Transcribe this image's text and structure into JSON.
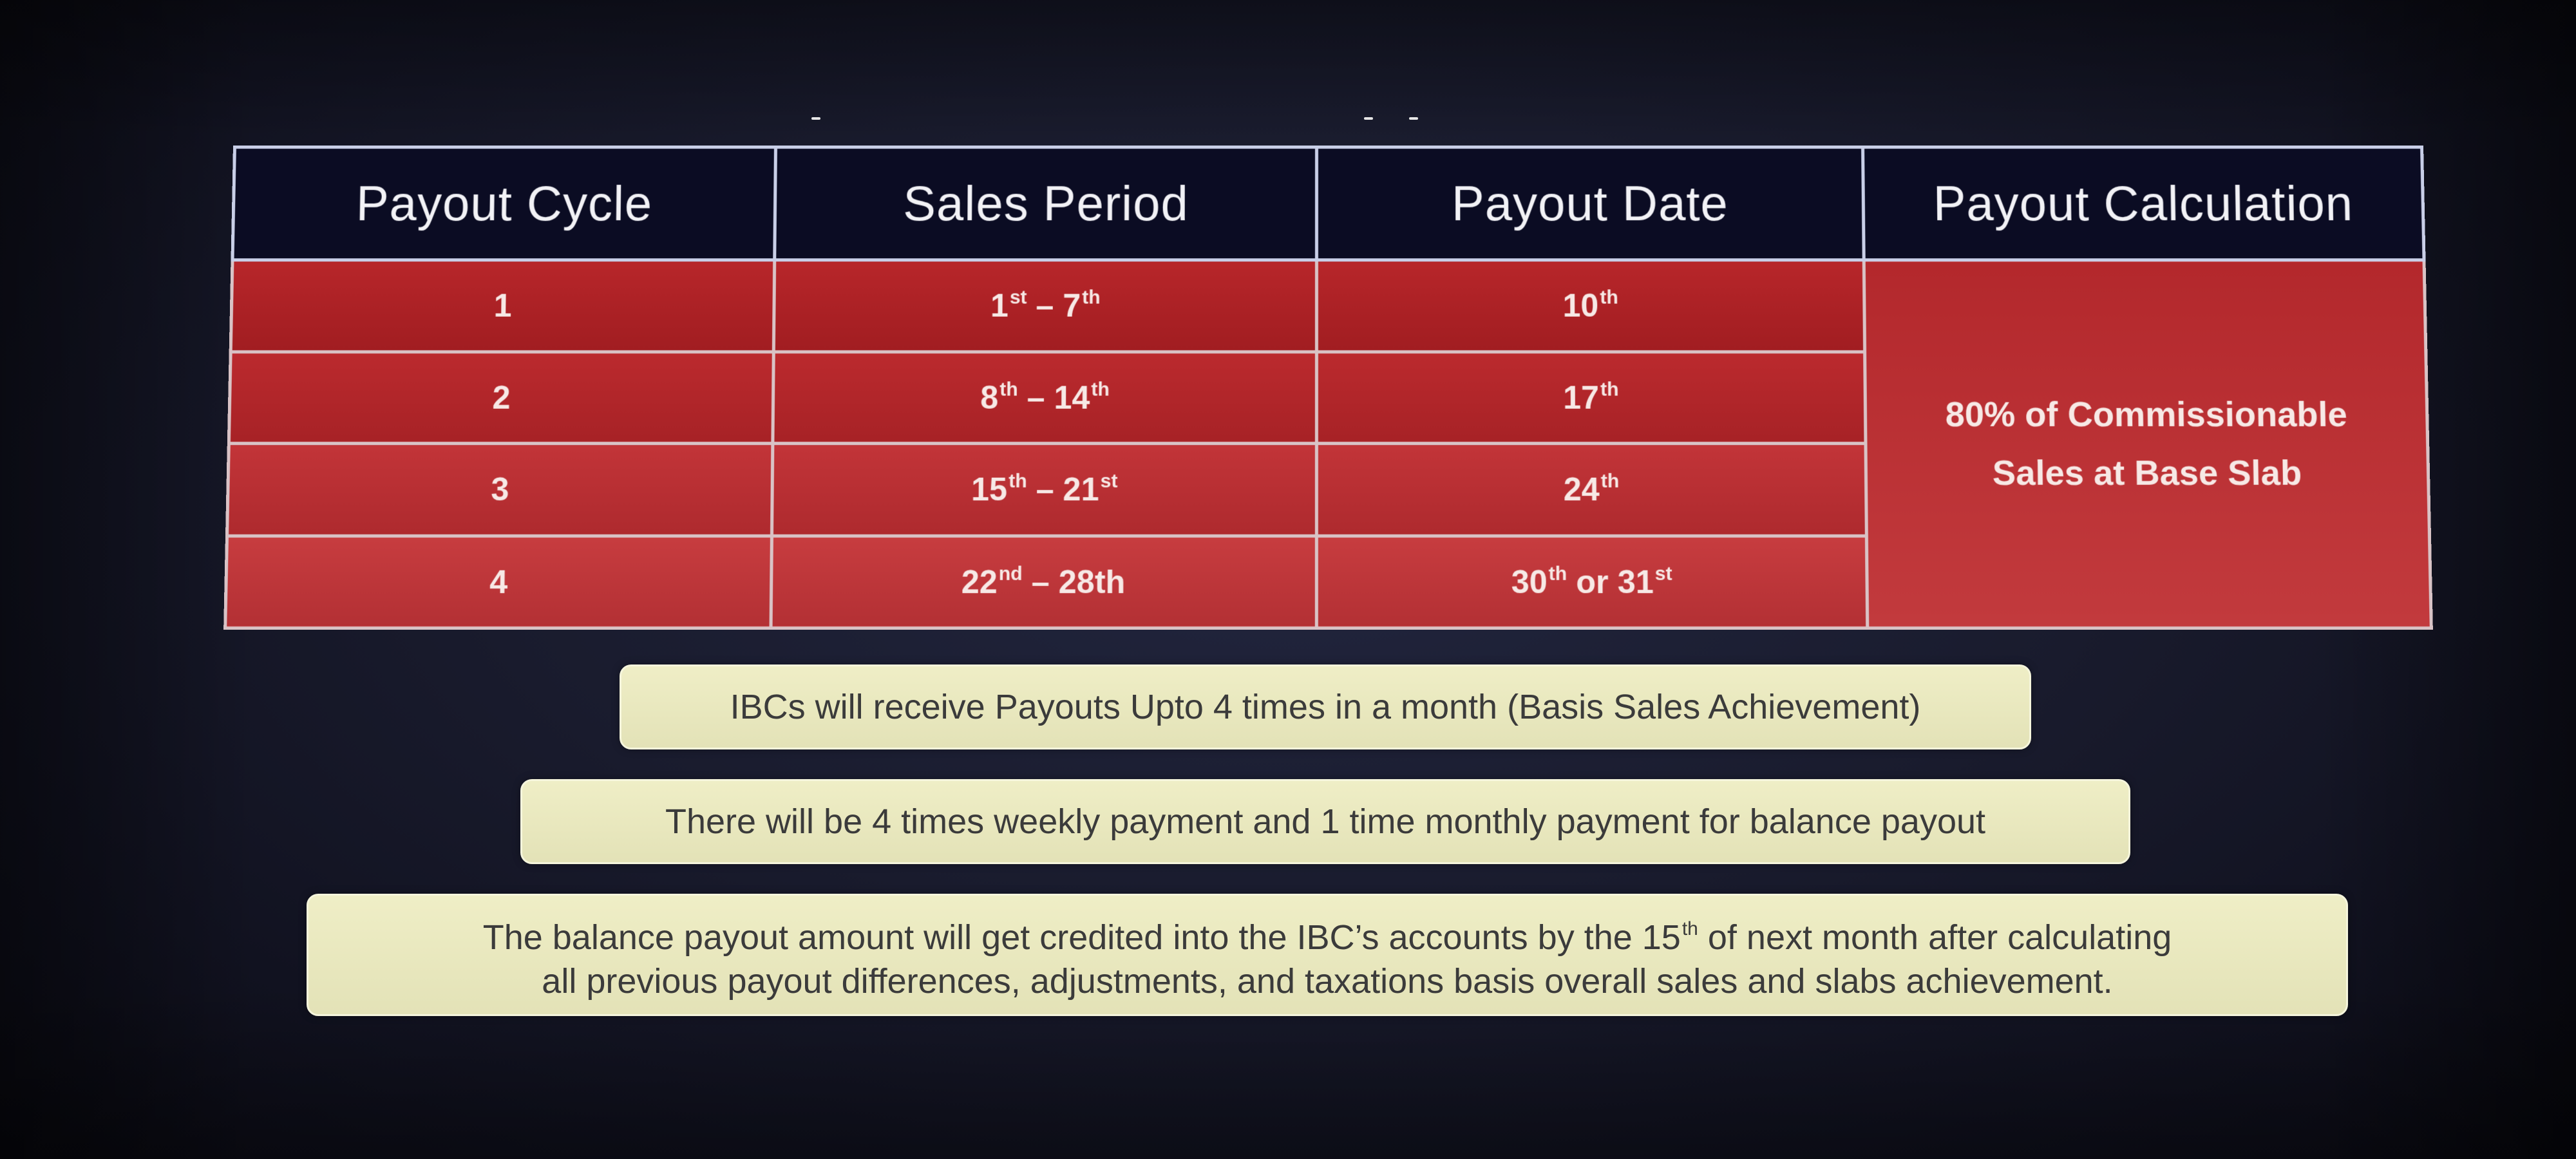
{
  "table": {
    "headers": [
      "Payout Cycle",
      "Sales Period",
      "Payout Date",
      "Payout Calculation"
    ],
    "rows": [
      {
        "cycle": "1",
        "period": {
          "start_num": "1",
          "start_sfx": "st",
          "sep": " – ",
          "end_num": "7",
          "end_sfx": "th"
        },
        "date": {
          "num": "10",
          "sfx": "th",
          "extra": "",
          "alt_num": "",
          "alt_sfx": ""
        }
      },
      {
        "cycle": "2",
        "period": {
          "start_num": "8",
          "start_sfx": "th",
          "sep": " – ",
          "end_num": "14",
          "end_sfx": "th"
        },
        "date": {
          "num": "17",
          "sfx": "th",
          "extra": "",
          "alt_num": "",
          "alt_sfx": ""
        }
      },
      {
        "cycle": "3",
        "period": {
          "start_num": "15",
          "start_sfx": "th",
          "sep": " – ",
          "end_num": "21",
          "end_sfx": "st"
        },
        "date": {
          "num": "24",
          "sfx": "th",
          "extra": "",
          "alt_num": "",
          "alt_sfx": ""
        }
      },
      {
        "cycle": "4",
        "period": {
          "start_num": "22",
          "start_sfx": "nd",
          "sep": " – ",
          "end_num": "28th",
          "end_sfx": ""
        },
        "date": {
          "num": "30",
          "sfx": "th",
          "extra": " or ",
          "alt_num": "31",
          "alt_sfx": "st"
        }
      }
    ],
    "calculation": {
      "line1": "80% of Commissionable",
      "line2": "Sales at Base Slab"
    }
  },
  "notes": {
    "note1": "IBCs will receive Payouts Upto 4 times in a month (Basis Sales Achievement)",
    "note2": "There will be 4 times weekly payment and 1 time monthly payment for balance payout",
    "note3": {
      "line1_before": "The balance payout amount will get credited into the IBC’s accounts by the 15",
      "line1_sup": "th",
      "line1_after": " of next month after calculating",
      "line2": "all previous payout differences, adjustments, and taxations basis overall sales and slabs achievement."
    }
  },
  "colors": {
    "header_bg": "#0b0c23",
    "row_red": "#b7262a",
    "note_bg": "#efeec6",
    "screen_bg": "#191b2d"
  }
}
